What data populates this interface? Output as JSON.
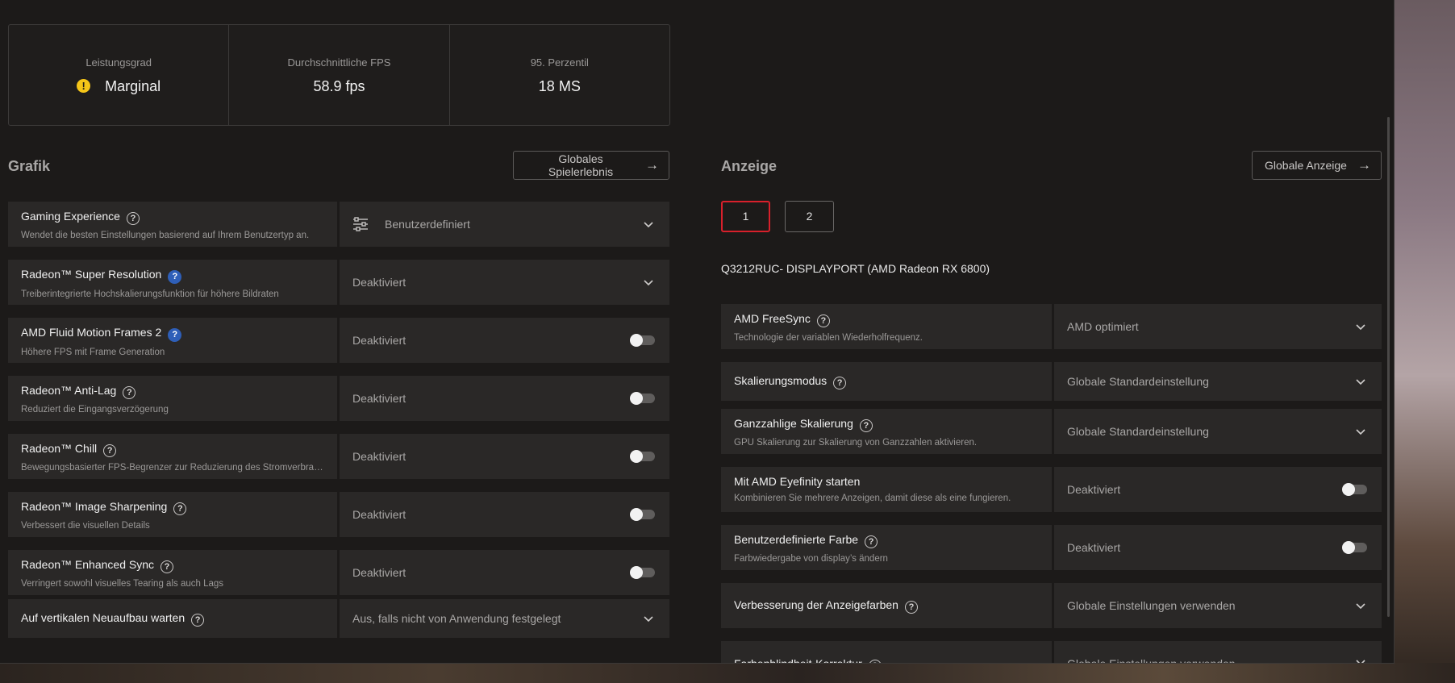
{
  "stats": [
    {
      "label": "Leistungsgrad",
      "value": "Marginal",
      "icon": "warning-icon"
    },
    {
      "label": "Durchschnittliche FPS",
      "value": "58.9 fps"
    },
    {
      "label": "95. Perzentil",
      "value": "18 MS"
    }
  ],
  "graphics": {
    "title": "Grafik",
    "global_button": "Globales Spielerlebnis",
    "rows": [
      {
        "title": "Gaming Experience",
        "desc": "Wendet die besten Einstellungen basierend auf Ihrem Benutzertyp an.",
        "value": "Benutzerdefiniert"
      },
      {
        "title": "Radeon™ Super Resolution",
        "desc": "Treiberintegrierte Hochskalierungsfunktion für höhere Bildraten",
        "value": "Deaktiviert"
      },
      {
        "title": "AMD Fluid Motion Frames 2",
        "desc": "Höhere FPS mit Frame Generation",
        "value": "Deaktiviert"
      },
      {
        "title": "Radeon™ Anti-Lag",
        "desc": "Reduziert die Eingangsverzögerung",
        "value": "Deaktiviert"
      },
      {
        "title": "Radeon™ Chill",
        "desc": "Bewegungsbasierter FPS-Begrenzer zur Reduzierung des Stromverbrau...",
        "value": "Deaktiviert"
      },
      {
        "title": "Radeon™ Image Sharpening",
        "desc": "Verbessert die visuellen Details",
        "value": "Deaktiviert"
      },
      {
        "title": "Radeon™ Enhanced Sync",
        "desc": "Verringert sowohl visuelles Tearing als auch Lags",
        "value": "Deaktiviert"
      },
      {
        "title": "Auf vertikalen Neuaufbau warten",
        "value": "Aus, falls nicht von Anwendung festgelegt"
      }
    ]
  },
  "display": {
    "title": "Anzeige",
    "global_button": "Globale Anzeige",
    "tabs": [
      "1",
      "2"
    ],
    "active_tab": "1",
    "monitor_name": "Q3212RUC- DISPLAYPORT (AMD Radeon RX 6800)",
    "rows": [
      {
        "title": "AMD FreeSync",
        "desc": "Technologie der variablen Wiederholfrequenz.",
        "value": "AMD optimiert"
      },
      {
        "title": "Skalierungsmodus",
        "value": "Globale Standardeinstellung"
      },
      {
        "title": "Ganzzahlige Skalierung",
        "desc": "GPU Skalierung zur Skalierung von Ganzzahlen aktivieren.",
        "value": "Globale Standardeinstellung"
      },
      {
        "title": "Mit AMD Eyefinity starten",
        "desc": "Kombinieren Sie mehrere Anzeigen, damit diese als eine fungieren.",
        "value": "Deaktiviert"
      },
      {
        "title": "Benutzerdefinierte Farbe",
        "desc": "Farbwiedergabe von display’s ändern",
        "value": "Deaktiviert"
      },
      {
        "title": "Verbesserung der Anzeigefarben",
        "value": "Globale Einstellungen verwenden"
      },
      {
        "title": "Farbenblindheit-Korrektur",
        "value": "Globale Einstellungen verwenden"
      }
    ]
  },
  "colors": {
    "accent": "#d8202b",
    "warning": "#f5c518",
    "help_blue": "#2f5fb8"
  }
}
